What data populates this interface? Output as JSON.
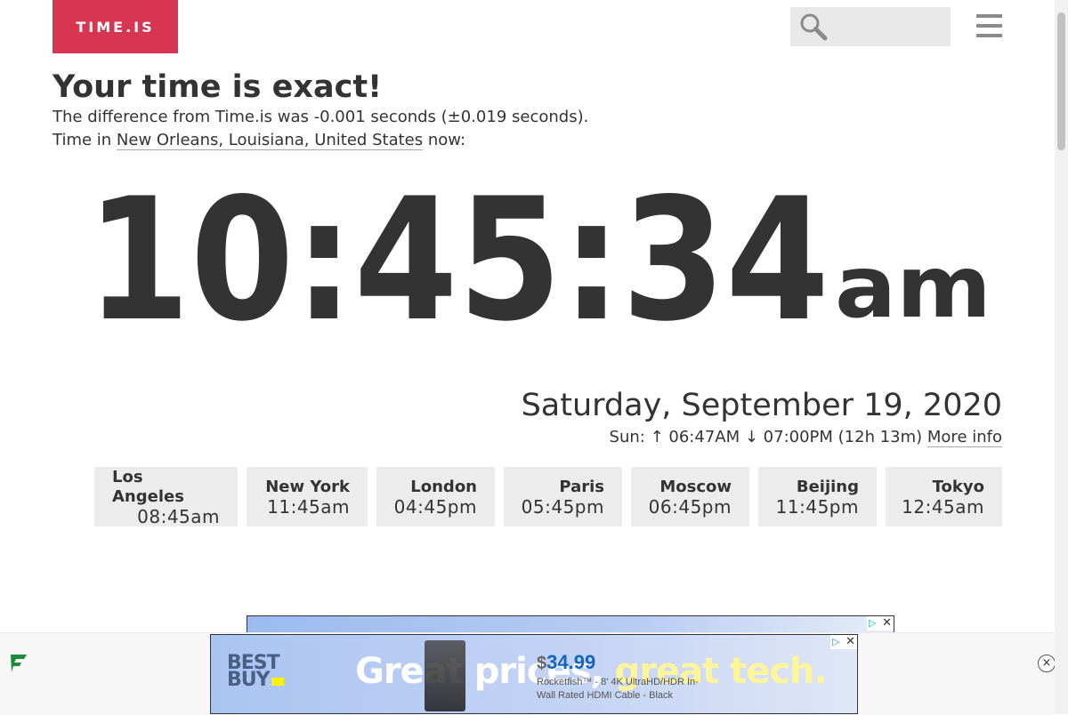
{
  "header": {
    "logo_text": "TIME.IS",
    "search": {
      "value": "",
      "placeholder": ""
    },
    "menu_icon": "hamburger-menu-icon",
    "search_icon": "magnifier-icon"
  },
  "status": {
    "headline": "Your time is exact!",
    "difference_text": "The difference from Time.is was -0.001 seconds (±0.019 seconds).",
    "location_prefix": "Time in ",
    "location_link": "New Orleans, Louisiana, United States",
    "location_suffix": " now:"
  },
  "clock": {
    "time": "10:45:34",
    "period": "am"
  },
  "date": {
    "full_date": "Saturday, September 19, 2020",
    "sun_prefix": "Sun: ",
    "sunrise_arrow": "↑",
    "sunrise": " 06:47AM ",
    "sunset_arrow": "↓",
    "sunset": " 07:00PM (12h 13m) ",
    "more_info_link": "More info"
  },
  "cities": [
    {
      "name": "Los Angeles",
      "time": "08:45am"
    },
    {
      "name": "New York",
      "time": "11:45am"
    },
    {
      "name": "London",
      "time": "04:45pm"
    },
    {
      "name": "Paris",
      "time": "05:45pm"
    },
    {
      "name": "Moscow",
      "time": "06:45pm"
    },
    {
      "name": "Beijing",
      "time": "11:45pm"
    },
    {
      "name": "Tokyo",
      "time": "12:45am"
    }
  ],
  "ad": {
    "brand": "BEST BUY",
    "slogan_part1": "Great prices,",
    "slogan_part2": " great tech.",
    "price_symbol": "$",
    "price": "34.99",
    "product": "Rocketfish™ - 8' 4K UltraHD/HDR In-Wall Rated HDMI Cable - Black",
    "adchoices_icon": "adchoices-icon",
    "ad_close_icon": "close-icon"
  },
  "bottom_bar": {
    "freestar_icon": "freestar-logo-icon",
    "close_label": "×"
  },
  "colors": {
    "brand_red": "#d63651",
    "text_dark": "#333333",
    "city_tile_bg": "#ececec"
  }
}
